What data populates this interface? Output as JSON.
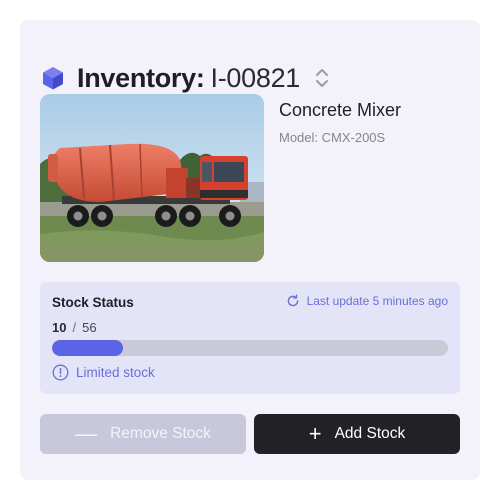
{
  "header": {
    "title_label": "Inventory:",
    "item_id": "I-00821",
    "icon": "cube-icon",
    "sort_icon": "sort-icon"
  },
  "product": {
    "name": "Concrete Mixer",
    "model": "Model: CMX-200S"
  },
  "stock": {
    "label": "Stock Status",
    "last_update": "Last update 5 minutes ago",
    "current": "10",
    "separator": "/",
    "total": "56",
    "fill_fraction": 0.1786,
    "warning": "Limited stock"
  },
  "actions": {
    "remove_label": "Remove Stock",
    "add_label": "Add Stock",
    "remove_icon": "minus-icon",
    "add_icon": "plus-icon"
  },
  "colors": {
    "accent": "#5b63e6",
    "panel": "#e4e4f8",
    "card": "#f3f2fb",
    "primary_button": "#222226",
    "disabled_button": "#c8c8dc"
  }
}
